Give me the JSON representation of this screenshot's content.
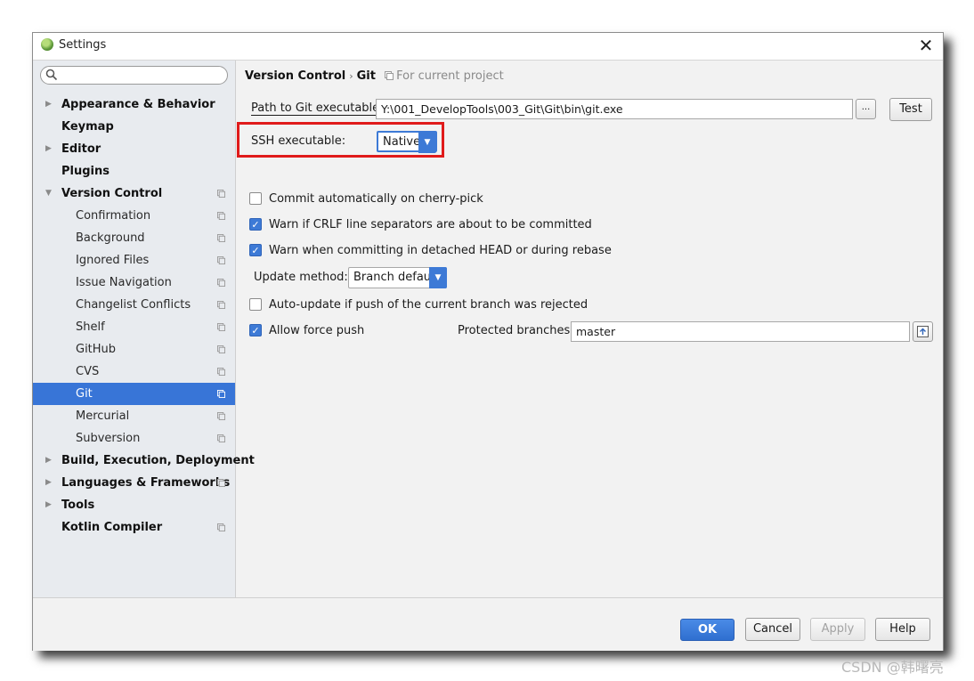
{
  "window": {
    "title": "Settings"
  },
  "search": {
    "value": "",
    "placeholder": ""
  },
  "sidebar": {
    "items": [
      {
        "label": "Appearance & Behavior",
        "level": 0,
        "expandable": true,
        "expanded": false,
        "project_scope": false,
        "selected": false
      },
      {
        "label": "Keymap",
        "level": 0,
        "expandable": false,
        "project_scope": false,
        "selected": false
      },
      {
        "label": "Editor",
        "level": 0,
        "expandable": true,
        "expanded": false,
        "project_scope": false,
        "selected": false
      },
      {
        "label": "Plugins",
        "level": 0,
        "expandable": false,
        "project_scope": false,
        "selected": false
      },
      {
        "label": "Version Control",
        "level": 0,
        "expandable": true,
        "expanded": true,
        "project_scope": true,
        "selected": false
      },
      {
        "label": "Confirmation",
        "level": 1,
        "project_scope": true,
        "selected": false
      },
      {
        "label": "Background",
        "level": 1,
        "project_scope": true,
        "selected": false
      },
      {
        "label": "Ignored Files",
        "level": 1,
        "project_scope": true,
        "selected": false
      },
      {
        "label": "Issue Navigation",
        "level": 1,
        "project_scope": true,
        "selected": false
      },
      {
        "label": "Changelist Conflicts",
        "level": 1,
        "project_scope": true,
        "selected": false
      },
      {
        "label": "Shelf",
        "level": 1,
        "project_scope": true,
        "selected": false
      },
      {
        "label": "GitHub",
        "level": 1,
        "project_scope": true,
        "selected": false
      },
      {
        "label": "CVS",
        "level": 1,
        "project_scope": true,
        "selected": false
      },
      {
        "label": "Git",
        "level": 1,
        "project_scope": true,
        "selected": true
      },
      {
        "label": "Mercurial",
        "level": 1,
        "project_scope": true,
        "selected": false
      },
      {
        "label": "Subversion",
        "level": 1,
        "project_scope": true,
        "selected": false
      },
      {
        "label": "Build, Execution, Deployment",
        "level": 0,
        "expandable": true,
        "expanded": false,
        "project_scope": false,
        "selected": false
      },
      {
        "label": "Languages & Frameworks",
        "level": 0,
        "expandable": true,
        "expanded": false,
        "project_scope": true,
        "selected": false
      },
      {
        "label": "Tools",
        "level": 0,
        "expandable": true,
        "expanded": false,
        "project_scope": false,
        "selected": false
      },
      {
        "label": "Kotlin Compiler",
        "level": 0,
        "expandable": false,
        "project_scope": true,
        "selected": false
      }
    ]
  },
  "breadcrumb": {
    "parent": "Version Control",
    "current": "Git",
    "separator": "›",
    "scope_note": "For current project"
  },
  "git": {
    "path_label": "Path to Git executable:",
    "path_value": "Y:\\001_DevelopTools\\003_Git\\Git\\bin\\git.exe",
    "browse_label": "...",
    "test_label": "Test",
    "ssh_label": "SSH executable:",
    "ssh_value": "Native",
    "cherry_pick_label": "Commit automatically on cherry-pick",
    "cherry_pick_checked": false,
    "crlf_label": "Warn if CRLF line separators are about to be committed",
    "crlf_checked": true,
    "detached_label": "Warn when committing in detached HEAD or during rebase",
    "detached_checked": true,
    "update_method_label": "Update method:",
    "update_method_value": "Branch default",
    "auto_update_label": "Auto-update if push of the current branch was rejected",
    "auto_update_checked": false,
    "force_push_label": "Allow force push",
    "force_push_checked": true,
    "protected_label": "Protected branches:",
    "protected_value": "master"
  },
  "footer": {
    "ok": "OK",
    "cancel": "Cancel",
    "apply": "Apply",
    "help": "Help"
  },
  "watermark": "CSDN @韩曙亮",
  "colors": {
    "selection": "#3875d7",
    "accent": "#3d7ad6",
    "highlight_box": "#e01b1b"
  }
}
